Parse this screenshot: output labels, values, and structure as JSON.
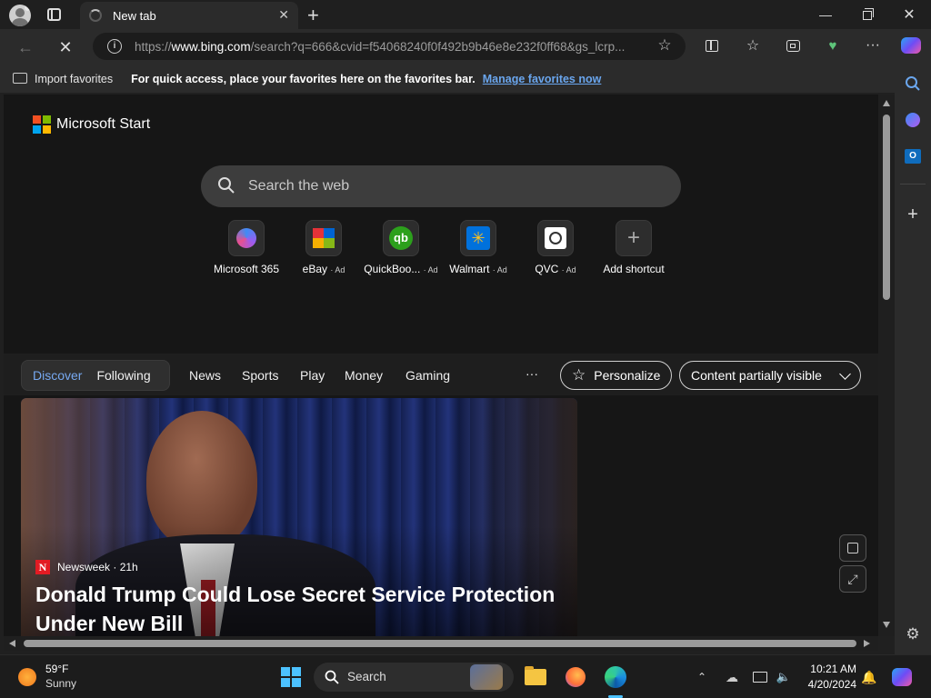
{
  "browser": {
    "tab_title": "New tab",
    "url_prefix": "https://",
    "url_domain": "www.bing.com",
    "url_rest": "/search?q=666&cvid=f54068240f0f492b9b46e8e232f0ff68&gs_lcrp..."
  },
  "favorites_bar": {
    "import_label": "Import favorites",
    "hint": "For quick access, place your favorites here on the favorites bar.",
    "manage_link": "Manage favorites now"
  },
  "page": {
    "brand": "Microsoft Start",
    "search_placeholder": "Search the web",
    "shortcuts": [
      {
        "label": "Microsoft 365",
        "ad": ""
      },
      {
        "label": "eBay",
        "ad": "· Ad"
      },
      {
        "label": "QuickBoo...",
        "ad": "· Ad"
      },
      {
        "label": "Walmart",
        "ad": "· Ad"
      },
      {
        "label": "QVC",
        "ad": "· Ad"
      },
      {
        "label": "Add shortcut",
        "ad": ""
      }
    ],
    "feed_tabs": {
      "discover": "Discover",
      "following": "Following",
      "links": [
        "News",
        "Sports",
        "Play",
        "Money",
        "Gaming"
      ],
      "more": "···",
      "personalize": "Personalize",
      "content_visibility": "Content partially visible"
    },
    "hero": {
      "source": "Newsweek",
      "age": "· 21h",
      "source_badge": "N",
      "headline": "Donald Trump Could Lose Secret Service Protection Under New Bill"
    }
  },
  "taskbar": {
    "weather_temp": "59°F",
    "weather_cond": "Sunny",
    "search_label": "Search",
    "time": "10:21 AM",
    "date": "4/20/2024"
  },
  "colors": {
    "accent_blue": "#6aa6ee",
    "discover_blue": "#77a9f1",
    "newsweek_red": "#e31b23"
  }
}
